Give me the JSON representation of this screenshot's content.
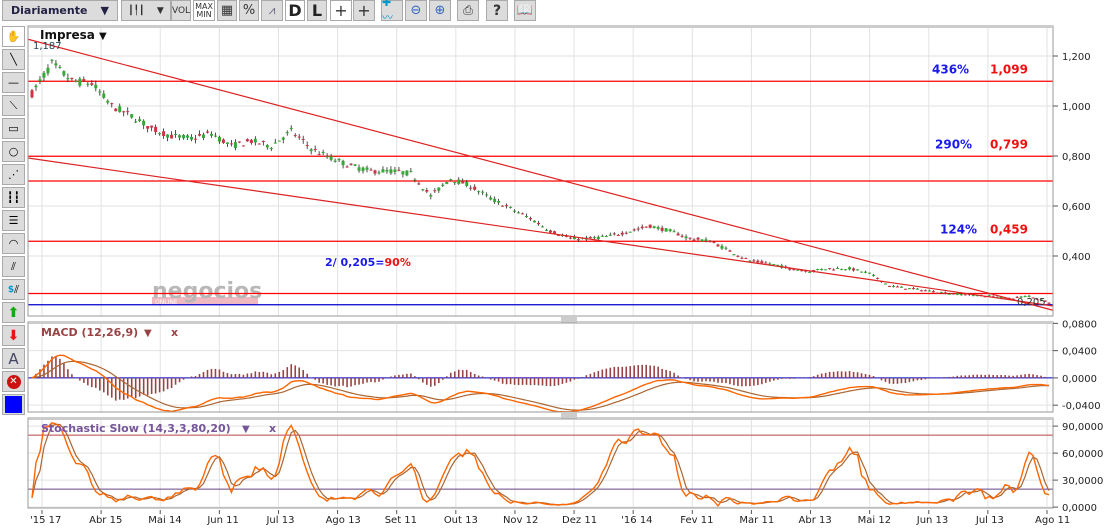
{
  "toolbar": {
    "period_select": "Diariamente",
    "vol_label": "VOL",
    "maxmin_label": "MAX MIN",
    "percent_label": "%",
    "d_label": "D",
    "l_label": "L",
    "help_label": "?"
  },
  "left_tools": {
    "text_tool_label": "A",
    "dollar_label": "$",
    "color_swatch": "#0000ff"
  },
  "main_panel": {
    "symbol": "Impresa",
    "high_label": "1,187",
    "last_label": "0,205",
    "y_ticks": [
      "1,200",
      "1,000",
      "0,800",
      "0,600",
      "0,400"
    ],
    "y_tick_values": [
      1.2,
      1.0,
      0.8,
      0.6,
      0.4
    ],
    "y_range": [
      0.16,
      1.32
    ],
    "watermark": "negocios",
    "watermark_sub": "ONLINE",
    "levels": [
      {
        "value": 1.099,
        "color": "#ff0000",
        "pct": "436%",
        "price": "1,099"
      },
      {
        "value": 0.799,
        "color": "#ff0000",
        "pct": "290%",
        "price": "0,799"
      },
      {
        "value": 0.7,
        "color": "#ff0000"
      },
      {
        "value": 0.459,
        "color": "#ff0000",
        "pct": "124%",
        "price": "0,459"
      },
      {
        "value": 0.25,
        "color": "#ff0000"
      },
      {
        "value": 0.205,
        "color": "#0000cc"
      }
    ],
    "annotation_blue": "2/ 0,205=",
    "annotation_red": "90%",
    "trendlines": [
      {
        "from": 1.267,
        "to": 0.183
      },
      {
        "from": 0.792,
        "to": 0.2
      }
    ]
  },
  "macd_panel": {
    "title": "MACD (12,26,9)",
    "close_label": "x",
    "y_ticks": [
      "0,0800",
      "0,0400",
      "0,0000",
      "-0,0400"
    ],
    "y_tick_values": [
      0.08,
      0.04,
      0.0,
      -0.04
    ],
    "y_range": [
      -0.05,
      0.082
    ]
  },
  "stoch_panel": {
    "title": "Stochastic Slow (14,3,3,80,20)",
    "close_label": "x",
    "y_ticks": [
      "90,0000",
      "60,0000",
      "30,0000",
      "0,0000"
    ],
    "y_tick_values": [
      90,
      60,
      30,
      0
    ],
    "y_range": [
      -1,
      99
    ],
    "upper": 80,
    "lower": 20
  },
  "x_axis": {
    "labels": [
      "'15 17",
      "Abr 15",
      "Mai 14",
      "Jun 11",
      "Jul 13",
      "Ago 13",
      "Set 11",
      "Out 13",
      "Nov 12",
      "Dez 11",
      "'16 14",
      "Fev 11",
      "Mar 11",
      "Abr 13",
      "Mai 12",
      "Jun 13",
      "Jul 13",
      "Ago 11"
    ]
  },
  "chart_data": {
    "type": "candlestick",
    "title": "Impresa",
    "closes_evenly_spaced": [
      1.05,
      1.17,
      1.1,
      1.09,
      1.0,
      0.96,
      0.91,
      0.88,
      0.87,
      0.89,
      0.84,
      0.86,
      0.84,
      0.9,
      0.83,
      0.79,
      0.76,
      0.74,
      0.74,
      0.73,
      0.64,
      0.71,
      0.68,
      0.63,
      0.59,
      0.55,
      0.5,
      0.47,
      0.47,
      0.48,
      0.5,
      0.52,
      0.5,
      0.47,
      0.46,
      0.42,
      0.38,
      0.37,
      0.35,
      0.34,
      0.35,
      0.35,
      0.33,
      0.28,
      0.27,
      0.26,
      0.25,
      0.245,
      0.24,
      0.23,
      0.24,
      0.215
    ],
    "up_color": "#33aa33",
    "down_color": "#cc3344"
  }
}
